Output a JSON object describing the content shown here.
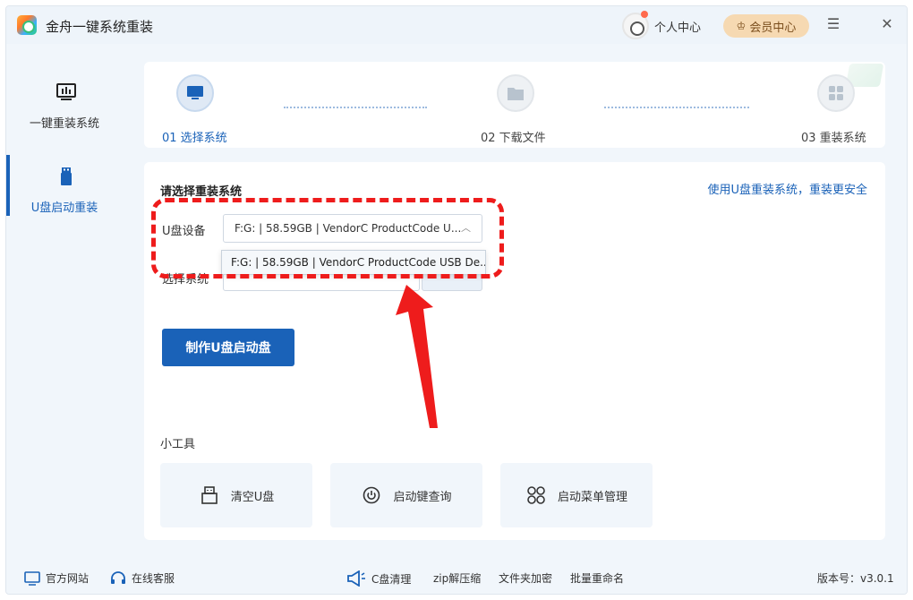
{
  "app": {
    "title": "金舟一键系统重装"
  },
  "header": {
    "personal_center": "个人中心",
    "vip_center": "会员中心",
    "minimize": "☰",
    "close": "✕"
  },
  "sidebar": {
    "items": [
      {
        "label": "一键重装系统"
      },
      {
        "label": "U盘启动重装"
      }
    ]
  },
  "steps": [
    {
      "label": "01 选择系统"
    },
    {
      "label": "02 下载文件"
    },
    {
      "label": "03 重装系统"
    }
  ],
  "main": {
    "section_title": "请选择重装系统",
    "safe_link": "使用U盘重装系统，重装更安全",
    "usb_label": "U盘设备",
    "usb_selected": "F:G: | 58.59GB | VendorC ProductCode U...",
    "usb_option": "F:G: | 58.59GB | VendorC ProductCode USB De...",
    "system_label": "选择系统",
    "make_button": "制作U盘启动盘",
    "tools_title": "小工具",
    "tools": [
      {
        "label": "清空U盘"
      },
      {
        "label": "启动键查询"
      },
      {
        "label": "启动菜单管理"
      }
    ]
  },
  "footer": {
    "website": "官方网站",
    "support": "在线客服",
    "c_clean": "C盘清理",
    "zip": "zip解压缩",
    "folder_encrypt": "文件夹加密",
    "batch_rename": "批量重命名",
    "version": "版本号：v3.0.1"
  },
  "colors": {
    "accent": "#1a62b8",
    "annotation": "#ee1c1c",
    "vip": "#f6d9b2"
  }
}
